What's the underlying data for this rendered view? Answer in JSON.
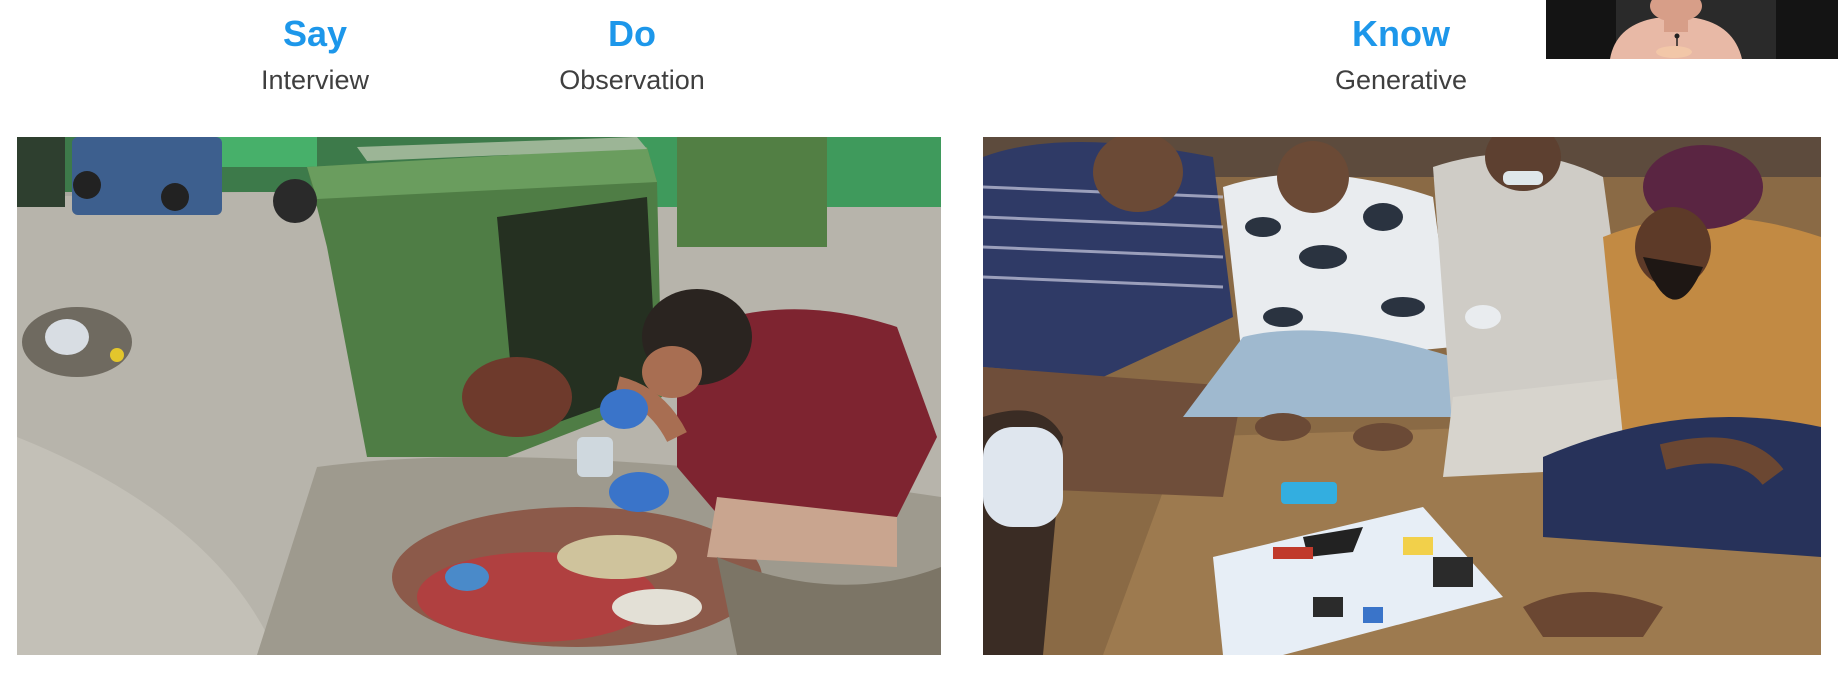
{
  "columns": {
    "say": {
      "title": "Say",
      "subtitle": "Interview"
    },
    "do": {
      "title": "Do",
      "subtitle": "Observation"
    },
    "know": {
      "title": "Know",
      "subtitle": "Generative"
    }
  },
  "photos": {
    "observation": {
      "description_icon": "waste-sorting-photo"
    },
    "generative": {
      "description_icon": "group-workshop-photo"
    }
  },
  "presenter": {
    "icon": "presenter-video-icon"
  },
  "colors": {
    "heading_blue": "#1d97ea",
    "subtitle_gray": "#3f3f3f",
    "background": "#ffffff"
  }
}
